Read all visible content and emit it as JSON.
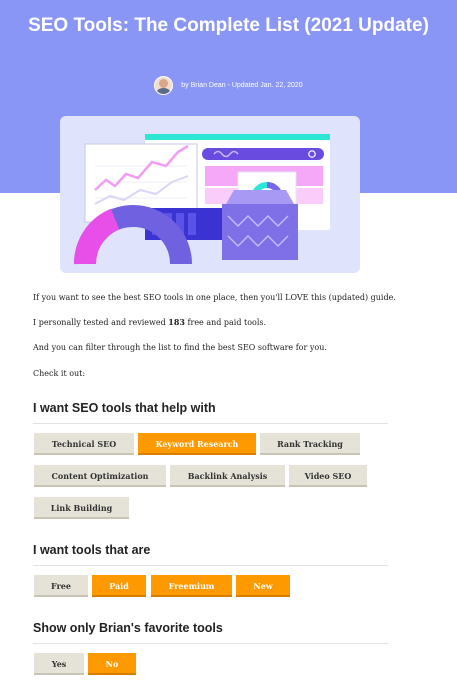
{
  "header": {
    "title": "SEO Tools: The Complete List (2021 Update)",
    "byline": "by Brian Dean - Updated Jan. 22, 2020"
  },
  "intro": {
    "p1": "If you want to see the best SEO tools in one place, then you'll LOVE this (updated) guide.",
    "p2_before": "I personally tested and reviewed ",
    "p2_number": "183",
    "p2_after": " free and paid tools.",
    "p3": "And you can filter through the list to find the best SEO software for you.",
    "p4": "Check it out:"
  },
  "filters": {
    "help_with": {
      "heading": "I want SEO tools that help with",
      "options": [
        {
          "label": "Technical SEO",
          "active": false
        },
        {
          "label": "Keyword Research",
          "active": true
        },
        {
          "label": "Rank Tracking",
          "active": false
        },
        {
          "label": "Content Optimization",
          "active": false
        },
        {
          "label": "Backlink Analysis",
          "active": false
        },
        {
          "label": "Video SEO",
          "active": false
        },
        {
          "label": "Link Building",
          "active": false
        }
      ]
    },
    "pricing": {
      "heading": "I want tools that are",
      "options": [
        {
          "label": "Free",
          "active": false
        },
        {
          "label": "Paid",
          "active": true
        },
        {
          "label": "Freemium",
          "active": true
        },
        {
          "label": "New",
          "active": true
        }
      ]
    },
    "favorites": {
      "heading": "Show only Brian's favorite tools",
      "options": [
        {
          "label": "Yes",
          "active": false
        },
        {
          "label": "No",
          "active": true
        }
      ]
    }
  },
  "colors": {
    "hero_bg": "#8a96f5",
    "accent_orange": "#ff9900",
    "chip_inactive": "#e5e2d7"
  }
}
